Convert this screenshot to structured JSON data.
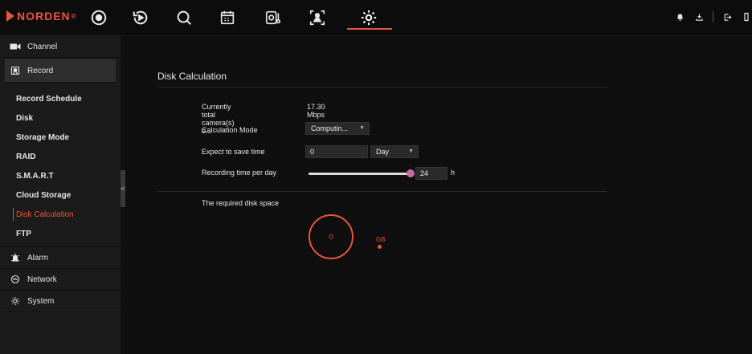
{
  "brand": {
    "name": "NORDEN",
    "reg": "®"
  },
  "topnav": {
    "items": [
      "live-view-icon",
      "playback-icon",
      "search-icon",
      "calendar-icon",
      "thermometer-icon",
      "face-detect-icon",
      "settings-gear-icon"
    ],
    "active": "settings-gear-icon"
  },
  "topright": {
    "icons": [
      "bell-icon",
      "download-icon",
      "logout-icon",
      "fullscreen-icon"
    ]
  },
  "sidebar": {
    "channel": "Channel",
    "record": "Record",
    "sub": [
      "Record Schedule",
      "Disk",
      "Storage Mode",
      "RAID",
      "S.M.A.R.T",
      "Cloud Storage",
      "Disk Calculation",
      "FTP"
    ],
    "alarm": "Alarm",
    "network": "Network",
    "system": "System",
    "collapse": "<"
  },
  "main": {
    "title": "Disk Calculation",
    "bitrate_label": "Currently total camera(s) b...",
    "bitrate_value": "17.30 Mbps",
    "mode_label": "Calculation Mode",
    "mode_value": "Computin...",
    "save_label": "Expect to save time",
    "save_value": "0",
    "save_unit": "Day",
    "rec_label": "Recording time per day",
    "rec_value": "24",
    "rec_unit": "h",
    "rec_slider_fraction": 1.0,
    "req_label": "The required disk space",
    "req_value": "0",
    "req_unit": "GB"
  },
  "colors": {
    "accent": "#e8553c",
    "slider_thumb": "#c56aa8"
  }
}
